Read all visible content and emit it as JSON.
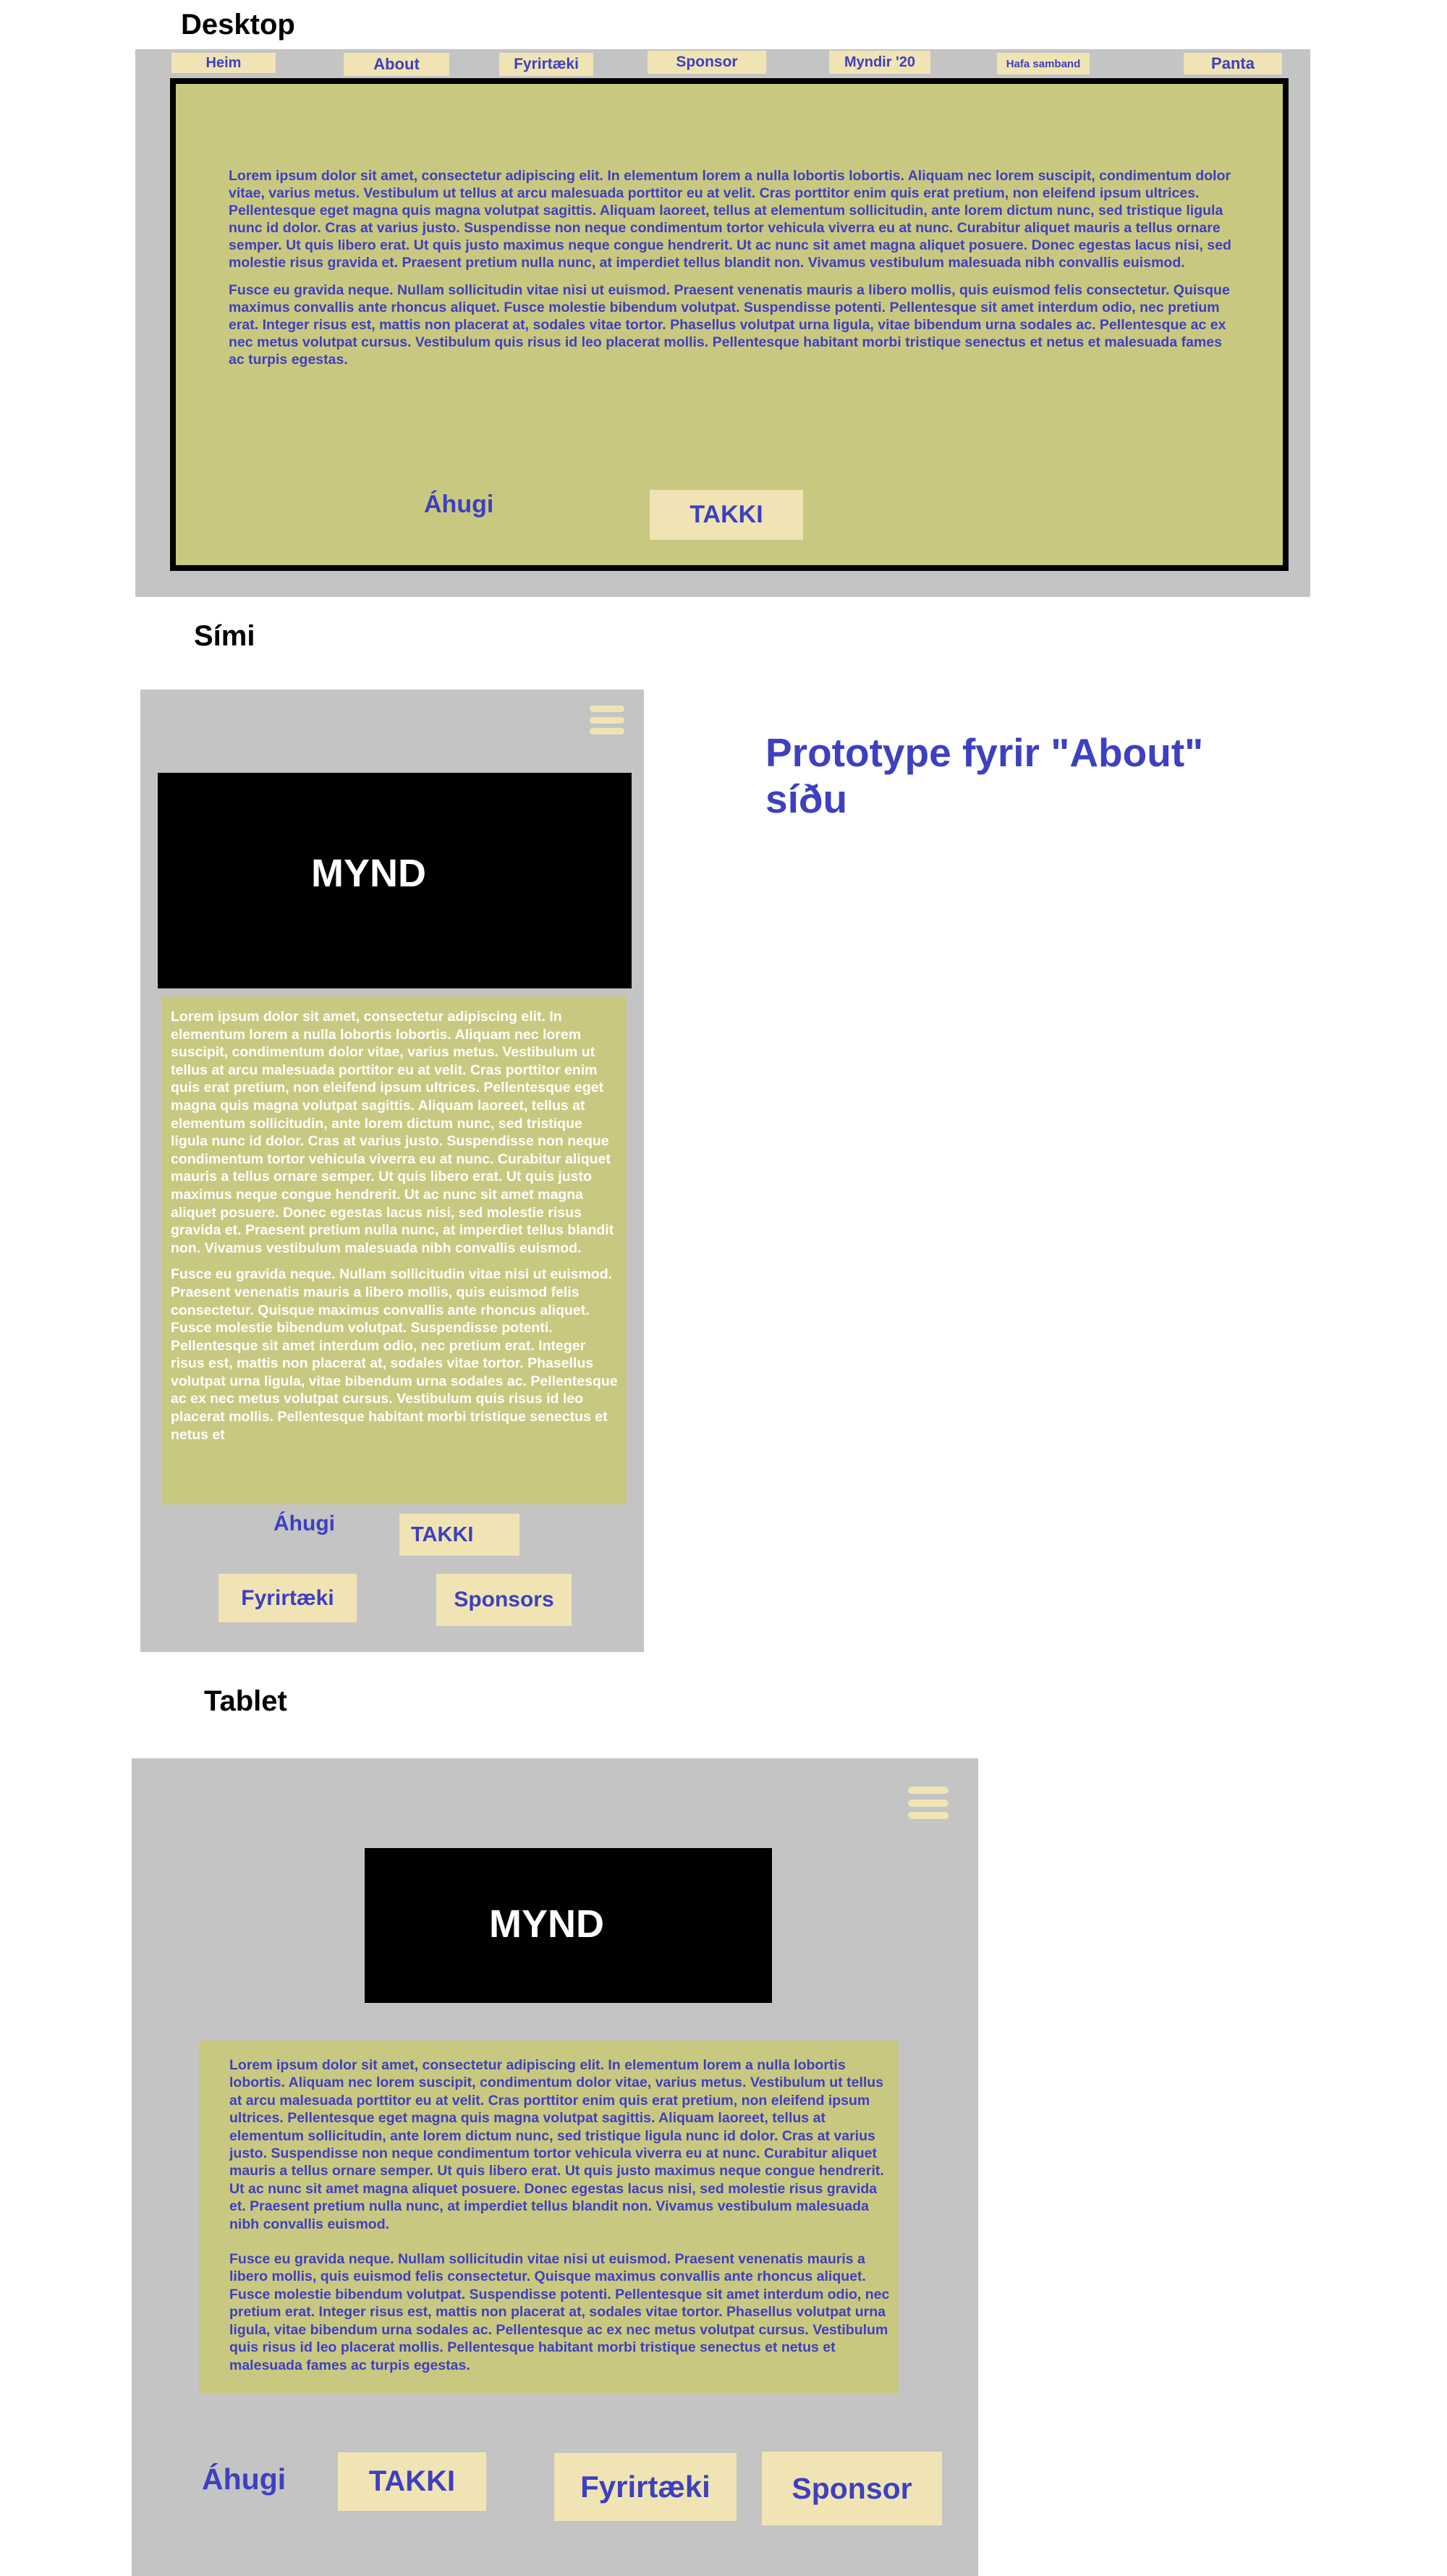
{
  "desktop": {
    "label": "Desktop",
    "nav": [
      "Heim",
      "About",
      "Fyrirtæki",
      "Sponsor",
      "Myndir '20",
      "Hafa samband",
      "Panta"
    ],
    "paragraphs": [
      "Lorem ipsum dolor sit amet, consectetur adipiscing elit. In elementum lorem a nulla lobortis lobortis. Aliquam nec lorem suscipit, condimentum dolor vitae, varius metus. Vestibulum ut tellus at arcu malesuada porttitor eu at velit. Cras porttitor enim quis erat pretium, non eleifend ipsum ultrices. Pellentesque eget magna quis magna volutpat sagittis. Aliquam laoreet, tellus at elementum sollicitudin, ante lorem dictum nunc, sed tristique ligula nunc id dolor. Cras at varius justo. Suspendisse non neque condimentum tortor vehicula viverra eu at nunc. Curabitur aliquet mauris a tellus ornare semper. Ut quis libero erat. Ut quis justo maximus neque congue hendrerit. Ut ac nunc sit amet magna aliquet posuere. Donec egestas lacus nisi, sed molestie risus gravida et. Praesent pretium nulla nunc, at imperdiet tellus blandit non. Vivamus vestibulum malesuada nibh convallis euismod.",
      "Fusce eu gravida neque. Nullam sollicitudin vitae nisi ut euismod. Praesent venenatis mauris a libero mollis, quis euismod felis consectetur. Quisque maximus convallis ante rhoncus aliquet. Fusce molestie bibendum volutpat. Suspendisse potenti. Pellentesque sit amet interdum odio, nec pretium erat. Integer risus est, mattis non placerat at, sodales vitae tortor. Phasellus volutpat urna ligula, vitae bibendum urna sodales ac. Pellentesque ac ex nec metus volutpat cursus. Vestibulum quis risus id leo placerat mollis. Pellentesque habitant morbi tristique senectus et netus et malesuada fames ac turpis egestas."
    ],
    "interest_link": "Áhugi",
    "thanks_button": "TAKKI"
  },
  "phone": {
    "label": "Sími",
    "image_label": "MYND",
    "paragraphs": [
      "Lorem ipsum dolor sit amet, consectetur adipiscing elit. In elementum lorem a nulla lobortis lobortis. Aliquam nec lorem suscipit, condimentum dolor vitae, varius metus. Vestibulum ut tellus at arcu malesuada porttitor eu at velit. Cras porttitor enim quis erat pretium, non eleifend ipsum ultrices. Pellentesque eget magna quis magna volutpat sagittis. Aliquam laoreet, tellus at elementum sollicitudin, ante lorem dictum nunc, sed tristique ligula nunc id dolor. Cras at varius justo. Suspendisse non neque condimentum tortor vehicula viverra eu at nunc. Curabitur aliquet mauris a tellus ornare semper. Ut quis libero erat. Ut quis justo maximus neque congue hendrerit. Ut ac nunc sit amet magna aliquet posuere. Donec egestas lacus nisi, sed molestie risus gravida et. Praesent pretium nulla nunc, at imperdiet tellus blandit non. Vivamus vestibulum malesuada nibh convallis euismod.",
      "Fusce eu gravida neque. Nullam sollicitudin vitae nisi ut euismod. Praesent venenatis mauris a libero mollis, quis euismod felis consectetur. Quisque maximus convallis ante rhoncus aliquet. Fusce molestie bibendum volutpat. Suspendisse potenti. Pellentesque sit amet interdum odio, nec pretium erat. Integer risus est, mattis non placerat at, sodales vitae tortor. Phasellus volutpat urna ligula, vitae bibendum urna sodales ac. Pellentesque ac ex nec metus volutpat cursus. Vestibulum quis risus id leo placerat mollis. Pellentesque habitant morbi tristique senectus et netus et"
    ],
    "interest_link": "Áhugi",
    "thanks_button": "TAKKI",
    "companies_button": "Fyrirtæki",
    "sponsors_button": "Sponsors"
  },
  "prototype_title": "Prototype fyrir \"About\" síðu",
  "tablet": {
    "label": "Tablet",
    "image_label": "MYND",
    "paragraphs": [
      "Lorem ipsum dolor sit amet, consectetur adipiscing elit. In elementum lorem a nulla lobortis lobortis. Aliquam nec lorem suscipit, condimentum dolor vitae, varius metus. Vestibulum ut tellus at arcu malesuada porttitor eu at velit. Cras porttitor enim quis erat pretium, non eleifend ipsum ultrices. Pellentesque eget magna quis magna volutpat sagittis. Aliquam laoreet, tellus at elementum sollicitudin, ante lorem dictum nunc, sed tristique ligula nunc id dolor. Cras at varius justo. Suspendisse non neque condimentum tortor vehicula viverra eu at nunc. Curabitur aliquet mauris a tellus ornare semper. Ut quis libero erat. Ut quis justo maximus neque congue hendrerit. Ut ac nunc sit amet magna aliquet posuere. Donec egestas lacus nisi, sed molestie risus gravida et. Praesent pretium nulla nunc, at imperdiet tellus blandit non. Vivamus vestibulum malesuada nibh convallis euismod.",
      "Fusce eu gravida neque. Nullam sollicitudin vitae nisi ut euismod. Praesent venenatis mauris a libero mollis, quis euismod felis consectetur. Quisque maximus convallis ante rhoncus aliquet. Fusce molestie bibendum volutpat. Suspendisse potenti. Pellentesque sit amet interdum odio, nec pretium erat. Integer risus est, mattis non placerat at, sodales vitae tortor. Phasellus volutpat urna ligula, vitae bibendum urna sodales ac. Pellentesque ac ex nec metus volutpat cursus. Vestibulum quis risus id leo placerat mollis. Pellentesque habitant morbi tristique senectus et netus et malesuada fames ac turpis egestas."
    ],
    "interest_link": "Áhugi",
    "thanks_button": "TAKKI",
    "companies_button": "Fyrirtæki",
    "sponsor_button": "Sponsor"
  },
  "colors": {
    "panel_grey": "#c4c4c4",
    "content_olive": "#c9c880",
    "button_tan": "#f0e4b4",
    "text_blue": "#3d40c0",
    "image_black": "#000000"
  },
  "icons": {
    "menu": "hamburger-menu-icon"
  }
}
